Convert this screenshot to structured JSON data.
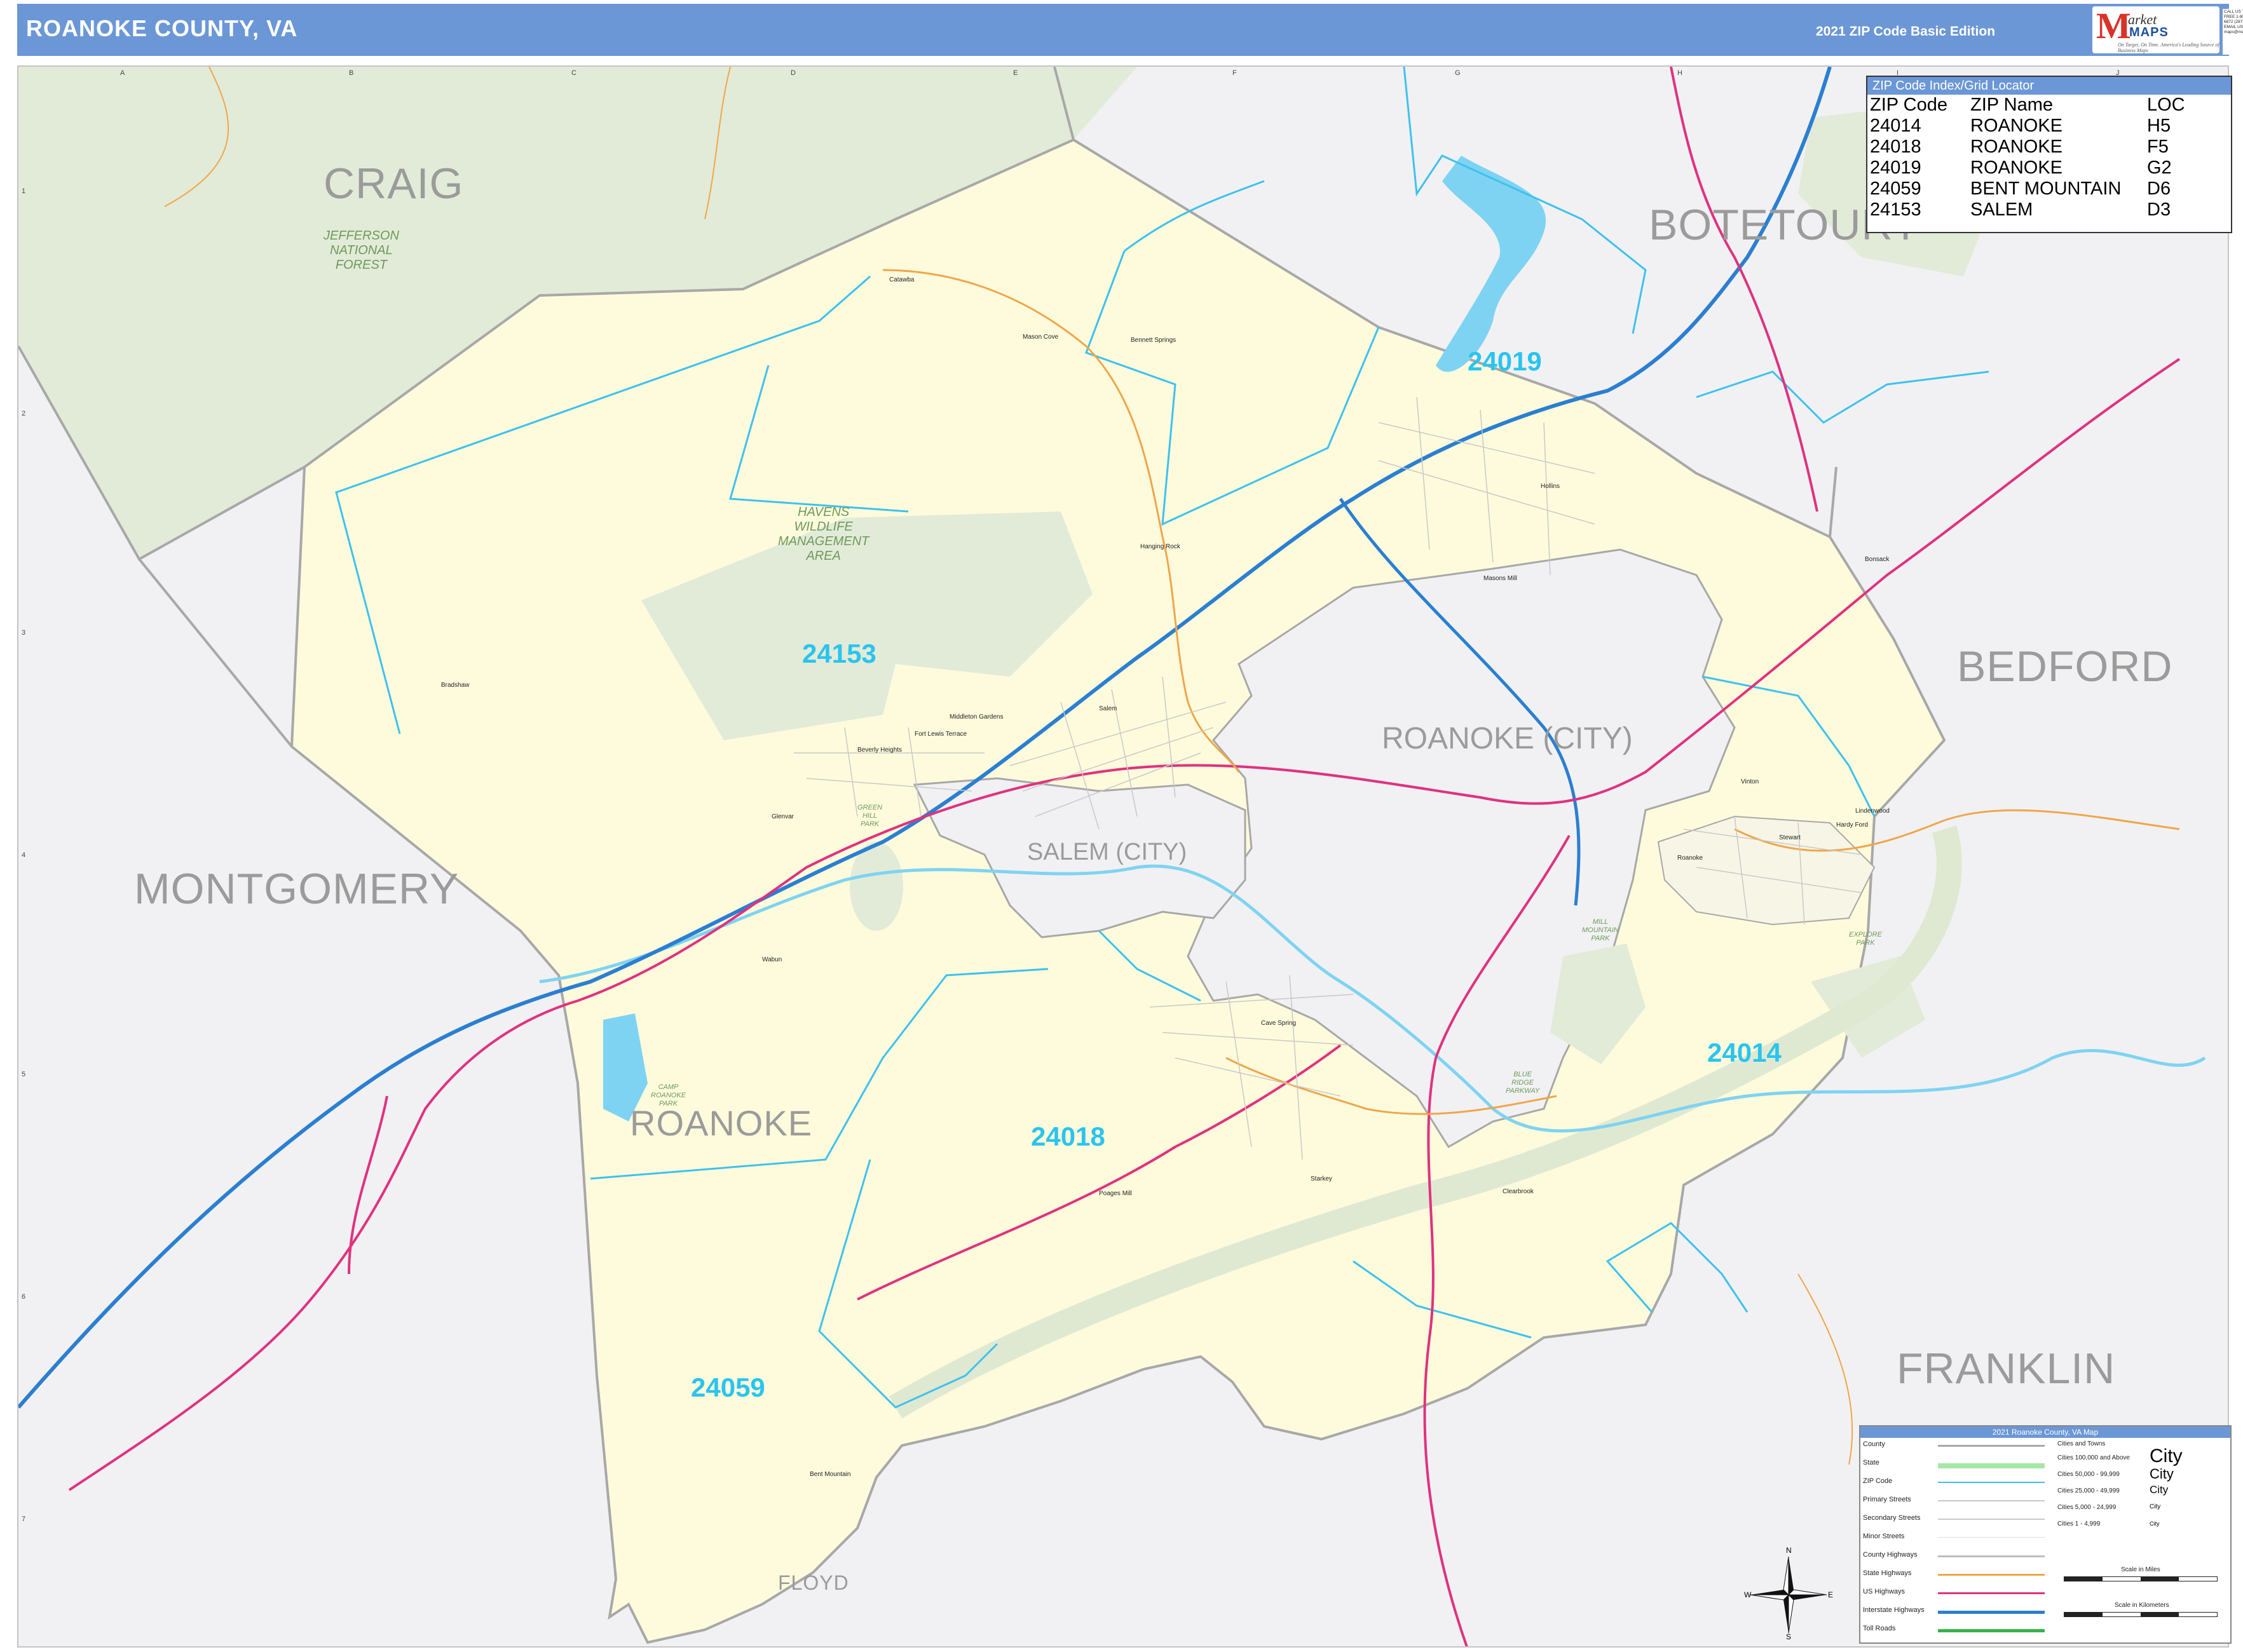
{
  "header": {
    "title": "ROANOKE COUNTY, VA",
    "edition": "2021 ZIP Code Basic Edition",
    "logo_brand": "Market MAPS",
    "logo_m": "M",
    "logo_ket": "arket",
    "logo_maps": "MAPS",
    "logo_tagline": "On Target, On Time. America's Leading Source of Business Maps",
    "contact_text": "CALL US TOLL FREE 1-800-334-6872 (2877) EMAIL US AT: maps@marketmaps.com"
  },
  "grid": {
    "letters": [
      "A",
      "B",
      "C",
      "D",
      "E",
      "F",
      "G",
      "H",
      "I",
      "J"
    ],
    "numbers": [
      "1",
      "2",
      "3",
      "4",
      "5",
      "6",
      "7"
    ]
  },
  "counties": {
    "craig": "CRAIG",
    "botetourt": "BOTETOURT",
    "bedford": "BEDFORD",
    "montgomery": "MONTGOMERY",
    "franklin": "FRANKLIN",
    "roanoke": "ROANOKE",
    "floyd": "FLOYD"
  },
  "cities": {
    "roanoke_city": "ROANOKE (CITY)",
    "salem_city": "SALEM (CITY)"
  },
  "zips": {
    "z24019": "24019",
    "z24153": "24153",
    "z24018": "24018",
    "z24014": "24014",
    "z24059": "24059"
  },
  "parks": {
    "jefferson": "JEFFERSON\nNATIONAL\nFOREST",
    "havens": "HAVENS\nWILDLIFE\nMANAGEMENT\nAREA",
    "green_hill": "GREEN\nHILL\nPARK",
    "blue_ridge": "BLUE\nRIDGE\nPARKWAY",
    "mill_mountain": "MILL\nMOUNTAIN\nPARK",
    "explore": "EXPLORE\nPARK",
    "camp_roanoke": "CAMP\nROANOKE\nPARK"
  },
  "towns": [
    {
      "name": "Catawba"
    },
    {
      "name": "Mason Cove"
    },
    {
      "name": "Bennett Springs"
    },
    {
      "name": "Hanging Rock"
    },
    {
      "name": "Hollins"
    },
    {
      "name": "Bradshaw"
    },
    {
      "name": "Salem"
    },
    {
      "name": "Glenvar"
    },
    {
      "name": "Fort Lewis Terrace"
    },
    {
      "name": "Beverly Heights"
    },
    {
      "name": "Middleton Gardens"
    },
    {
      "name": "Vinton"
    },
    {
      "name": "Cave Spring"
    },
    {
      "name": "Starkey"
    },
    {
      "name": "Clearbrook"
    },
    {
      "name": "Bent Mountain"
    },
    {
      "name": "Poages Mill"
    },
    {
      "name": "Bonsack"
    },
    {
      "name": "Lindenwood"
    },
    {
      "name": "Hardy Ford"
    },
    {
      "name": "Stewart"
    },
    {
      "name": "Masons Mill"
    },
    {
      "name": "Wabun"
    },
    {
      "name": "Roanoke"
    }
  ],
  "zip_index": {
    "title": "ZIP Code Index/Grid Locator",
    "columns": [
      "ZIP Code",
      "ZIP Name",
      "LOC"
    ],
    "rows": [
      [
        "24014",
        "ROANOKE",
        "H5"
      ],
      [
        "24018",
        "ROANOKE",
        "F5"
      ],
      [
        "24019",
        "ROANOKE",
        "G2"
      ],
      [
        "24059",
        "BENT MOUNTAIN",
        "D6"
      ],
      [
        "24153",
        "SALEM",
        "D3"
      ]
    ]
  },
  "legend": {
    "title": "2021 Roanoke County, VA Map",
    "items": [
      "County",
      "State",
      "ZIP Code",
      "Primary Streets",
      "Secondary Streets",
      "Minor Streets",
      "County Highways",
      "State Highways",
      "US Highways",
      "Interstate Highways",
      "Toll Roads"
    ],
    "city_sizes": [
      "Cities and Towns",
      "Cities 100,000 and Above",
      "Cities 50,000 - 99,999",
      "Cities 25,000 - 49,999",
      "Cities 5,000 - 24,999",
      "Cities 1 - 4,999"
    ],
    "city_samples": [
      "City",
      "City",
      "City",
      "City",
      "City"
    ],
    "scale_miles": "Scale in Miles",
    "scale_km": "Scale in Kilometers",
    "colors": {
      "county": "#a8a8a8",
      "state": "#a5e8a5",
      "zip": "#3fc1ee",
      "primary": "#c9c9c9",
      "secondary": "#c9c9c9",
      "minor": "#dedede",
      "county_hwy": "#bdbdbd",
      "state_hwy": "#f0a64a",
      "us_hwy": "#e0327f",
      "interstate": "#2b7fd1",
      "toll": "#36b34a"
    }
  },
  "compass": {
    "n": "N",
    "s": "S",
    "e": "E",
    "w": "W"
  },
  "colors": {
    "roanoke_county_fill": "#fdfbdc",
    "other_county_fill": "#f1f1f3",
    "forest_fill": "#e2ebd8",
    "zip_boundary": "#3fc1ee",
    "county_boundary": "#a8a8a8",
    "water": "#7fd3f2",
    "header_bg": "#6b97d6"
  }
}
